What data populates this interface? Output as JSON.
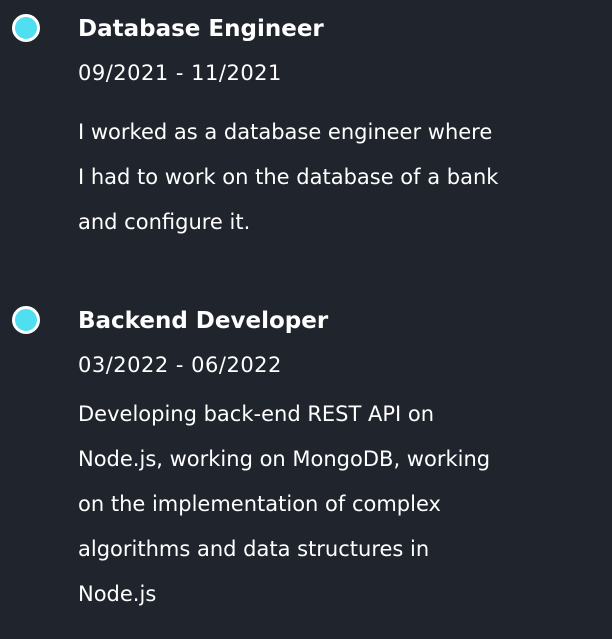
{
  "colors": {
    "background": "#1f242d",
    "accent": "#4fdff0",
    "text": "#ffffff"
  },
  "timeline": {
    "entries": [
      {
        "icon": "circle-marker-icon",
        "title": "Database Engineer",
        "date": "09/2021 - 11/2021",
        "description_lines": [
          "I worked as a database engineer where",
          "I had to work on the database of a bank",
          "and configure it."
        ]
      },
      {
        "icon": "circle-marker-icon",
        "title": "Backend Developer",
        "date": "03/2022 - 06/2022",
        "description_lines": [
          "Developing back-end REST API on",
          "Node.js, working on MongoDB, working",
          "on the implementation of complex",
          "algorithms and data structures in",
          "Node.js"
        ]
      }
    ]
  }
}
